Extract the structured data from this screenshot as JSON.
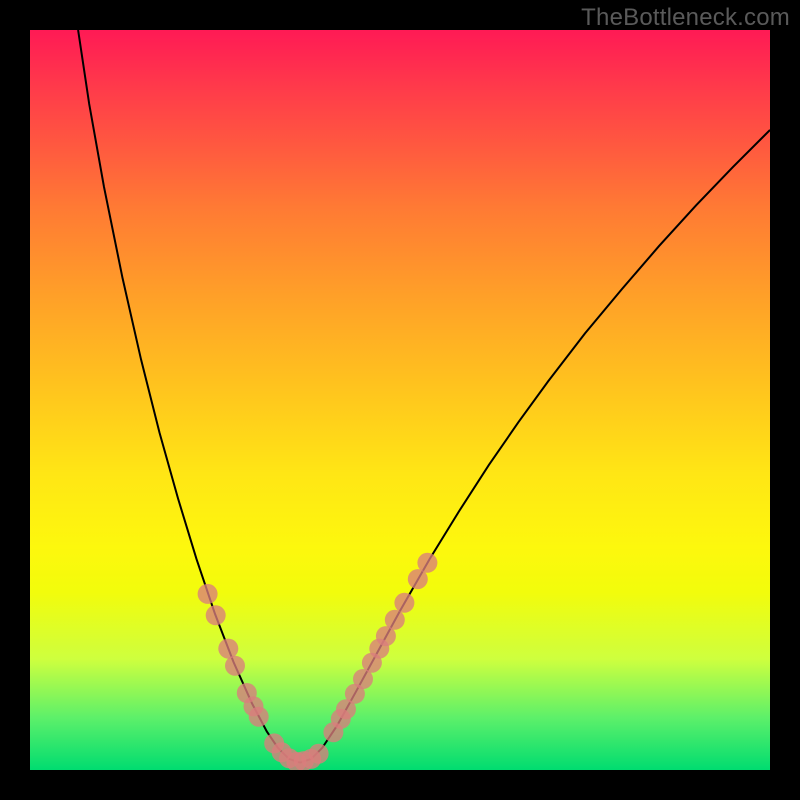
{
  "watermark": "TheBottleneck.com",
  "chart_data": {
    "type": "line",
    "title": "",
    "xlabel": "",
    "ylabel": "",
    "xlim": [
      0,
      100
    ],
    "ylim": [
      0,
      100
    ],
    "background_gradient_stops": [
      {
        "pos": 0,
        "color": "#ff1a55"
      },
      {
        "pos": 8,
        "color": "#ff3b4a"
      },
      {
        "pos": 16,
        "color": "#ff5a3f"
      },
      {
        "pos": 24,
        "color": "#ff7a34"
      },
      {
        "pos": 36,
        "color": "#ffa028"
      },
      {
        "pos": 48,
        "color": "#ffc31e"
      },
      {
        "pos": 60,
        "color": "#ffe615"
      },
      {
        "pos": 70,
        "color": "#fdf80d"
      },
      {
        "pos": 76,
        "color": "#f2fc0c"
      },
      {
        "pos": 85,
        "color": "#ceff3e"
      },
      {
        "pos": 93,
        "color": "#5cf06a"
      },
      {
        "pos": 100,
        "color": "#00dc70"
      }
    ],
    "series": [
      {
        "name": "bottleneck-curve",
        "points": [
          {
            "x": 6.5,
            "y": 100.0
          },
          {
            "x": 8.0,
            "y": 90.0
          },
          {
            "x": 10.0,
            "y": 78.8
          },
          {
            "x": 12.5,
            "y": 66.5
          },
          {
            "x": 15.0,
            "y": 55.5
          },
          {
            "x": 17.5,
            "y": 45.6
          },
          {
            "x": 20.0,
            "y": 36.7
          },
          {
            "x": 22.5,
            "y": 28.5
          },
          {
            "x": 25.0,
            "y": 21.1
          },
          {
            "x": 27.5,
            "y": 14.6
          },
          {
            "x": 30.0,
            "y": 9.0
          },
          {
            "x": 32.0,
            "y": 5.2
          },
          {
            "x": 33.5,
            "y": 3.0
          },
          {
            "x": 35.0,
            "y": 1.5
          },
          {
            "x": 36.5,
            "y": 1.0
          },
          {
            "x": 38.0,
            "y": 1.5
          },
          {
            "x": 39.5,
            "y": 3.0
          },
          {
            "x": 41.5,
            "y": 6.0
          },
          {
            "x": 44.0,
            "y": 10.5
          },
          {
            "x": 47.0,
            "y": 16.0
          },
          {
            "x": 50.0,
            "y": 21.5
          },
          {
            "x": 54.0,
            "y": 28.5
          },
          {
            "x": 58.0,
            "y": 35.0
          },
          {
            "x": 62.0,
            "y": 41.2
          },
          {
            "x": 66.0,
            "y": 47.0
          },
          {
            "x": 70.0,
            "y": 52.5
          },
          {
            "x": 75.0,
            "y": 59.0
          },
          {
            "x": 80.0,
            "y": 65.0
          },
          {
            "x": 85.0,
            "y": 70.8
          },
          {
            "x": 90.0,
            "y": 76.3
          },
          {
            "x": 95.0,
            "y": 81.5
          },
          {
            "x": 100.0,
            "y": 86.5
          }
        ]
      },
      {
        "name": "highlight-markers-left",
        "points": [
          {
            "x": 24.0,
            "y": 23.8
          },
          {
            "x": 25.1,
            "y": 20.9
          },
          {
            "x": 26.8,
            "y": 16.4
          },
          {
            "x": 27.7,
            "y": 14.1
          },
          {
            "x": 29.3,
            "y": 10.4
          },
          {
            "x": 30.2,
            "y": 8.6
          },
          {
            "x": 30.9,
            "y": 7.2
          }
        ]
      },
      {
        "name": "highlight-markers-bottom",
        "points": [
          {
            "x": 33.0,
            "y": 3.6
          },
          {
            "x": 34.0,
            "y": 2.4
          },
          {
            "x": 35.0,
            "y": 1.6
          },
          {
            "x": 36.0,
            "y": 1.1
          },
          {
            "x": 37.0,
            "y": 1.2
          },
          {
            "x": 38.0,
            "y": 1.5
          },
          {
            "x": 39.0,
            "y": 2.2
          }
        ]
      },
      {
        "name": "highlight-markers-right",
        "points": [
          {
            "x": 41.0,
            "y": 5.1
          },
          {
            "x": 42.0,
            "y": 6.9
          },
          {
            "x": 42.7,
            "y": 8.2
          },
          {
            "x": 43.9,
            "y": 10.3
          },
          {
            "x": 45.0,
            "y": 12.3
          },
          {
            "x": 46.2,
            "y": 14.5
          },
          {
            "x": 47.2,
            "y": 16.4
          },
          {
            "x": 48.1,
            "y": 18.1
          },
          {
            "x": 49.3,
            "y": 20.3
          },
          {
            "x": 50.6,
            "y": 22.6
          },
          {
            "x": 52.4,
            "y": 25.8
          },
          {
            "x": 53.7,
            "y": 28.0
          }
        ]
      }
    ],
    "marker_style": {
      "shape": "circle",
      "radius": 10,
      "fill": "#da7d7c",
      "opacity": 0.78
    }
  }
}
